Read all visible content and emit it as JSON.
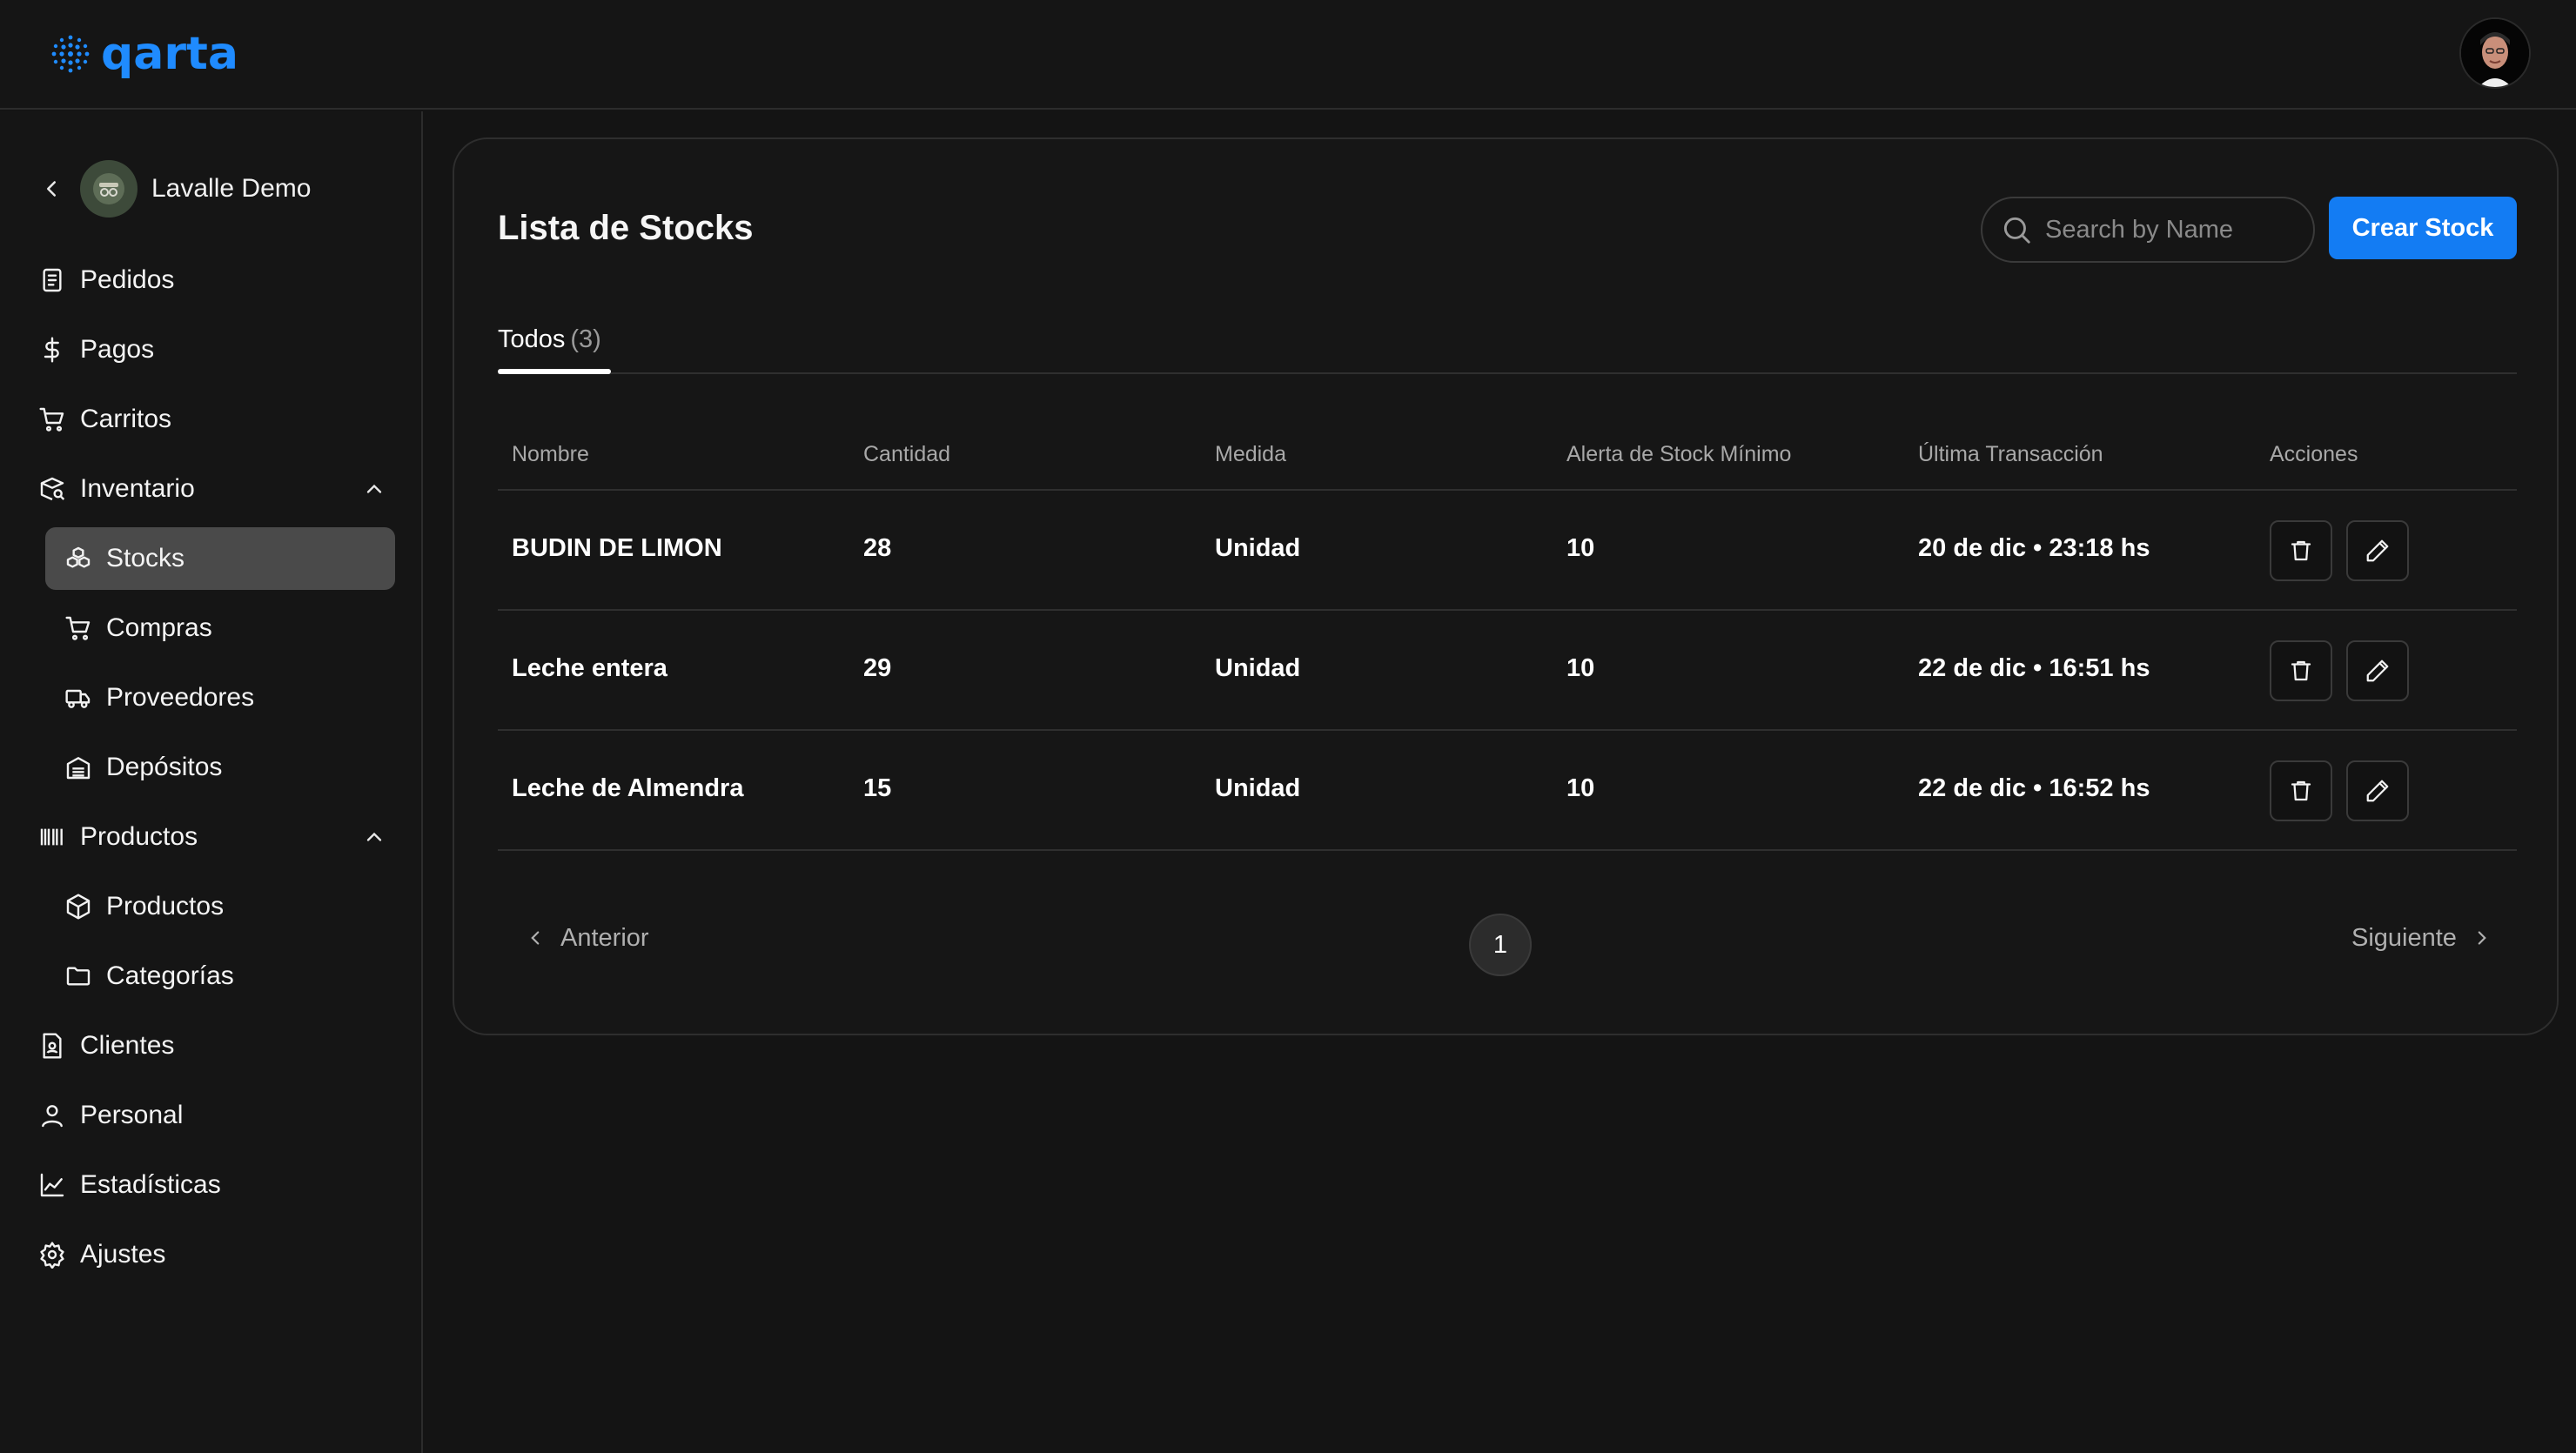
{
  "brand": {
    "name": "qarta",
    "accent": "#1f8bff"
  },
  "header": {
    "avatar_icon": "user-avatar"
  },
  "sidebar": {
    "store": {
      "name": "Lavalle Demo",
      "icon": "chevron-left"
    },
    "items": [
      {
        "label": "Pedidos",
        "icon": "receipt-icon"
      },
      {
        "label": "Pagos",
        "icon": "dollar-icon"
      },
      {
        "label": "Carritos",
        "icon": "cart-icon"
      },
      {
        "label": "Inventario",
        "icon": "inventory-icon",
        "expanded": true
      },
      {
        "label": "Stocks",
        "icon": "boxes-icon",
        "active": true
      },
      {
        "label": "Compras",
        "icon": "cart-icon"
      },
      {
        "label": "Proveedores",
        "icon": "truck-icon"
      },
      {
        "label": "Depósitos",
        "icon": "warehouse-icon"
      },
      {
        "label": "Productos",
        "icon": "barcode-icon",
        "expanded": true
      },
      {
        "label": "Productos",
        "icon": "package-icon"
      },
      {
        "label": "Categorías",
        "icon": "folder-icon"
      },
      {
        "label": "Clientes",
        "icon": "contact-icon"
      },
      {
        "label": "Personal",
        "icon": "user-icon"
      },
      {
        "label": "Estadísticas",
        "icon": "chart-line-icon"
      },
      {
        "label": "Ajustes",
        "icon": "gear-icon"
      }
    ]
  },
  "main": {
    "title": "Lista de Stocks",
    "search": {
      "placeholder": "Search by Name",
      "value": ""
    },
    "create_label": "Crear Stock",
    "tabs": [
      {
        "label": "Todos",
        "count": "(3)",
        "active": true
      }
    ],
    "table": {
      "columns": [
        "Nombre",
        "Cantidad",
        "Medida",
        "Alerta de Stock Mínimo",
        "Última Transacción",
        "Acciones"
      ],
      "rows": [
        {
          "nombre": "BUDIN DE LIMON",
          "cantidad": "28",
          "medida": "Unidad",
          "alerta": "10",
          "ultima": "20 de dic • 23:18 hs"
        },
        {
          "nombre": "Leche entera",
          "cantidad": "29",
          "medida": "Unidad",
          "alerta": "10",
          "ultima": "22 de dic • 16:51 hs"
        },
        {
          "nombre": "Leche de Almendra",
          "cantidad": "15",
          "medida": "Unidad",
          "alerta": "10",
          "ultima": "22 de dic • 16:52 hs"
        }
      ]
    },
    "pagination": {
      "prev_label": "Anterior",
      "next_label": "Siguiente",
      "current_page": "1"
    }
  }
}
